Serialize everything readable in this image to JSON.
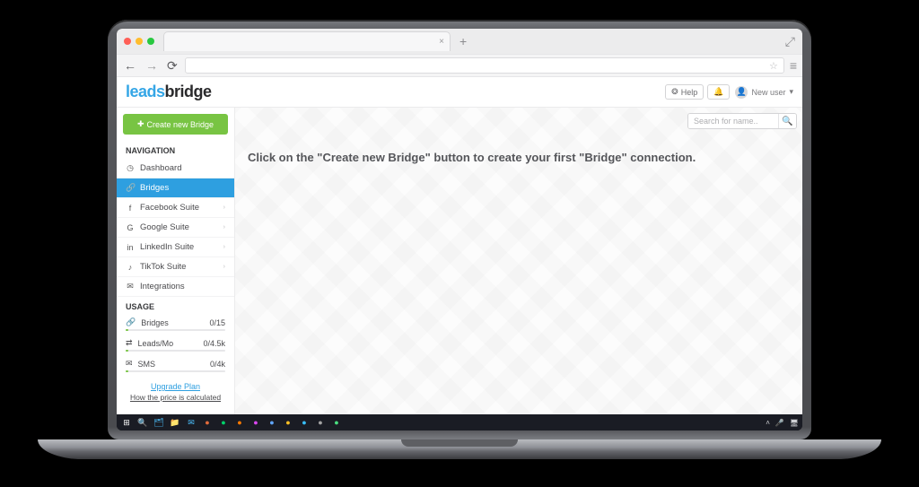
{
  "logo": {
    "part1": "leads",
    "part2": "bridge"
  },
  "header": {
    "help_label": "Help",
    "user_label": "New user"
  },
  "sidebar": {
    "create_label": "Create new Bridge",
    "nav_title": "NAVIGATION",
    "items": [
      {
        "label": "Dashboard"
      },
      {
        "label": "Bridges"
      },
      {
        "label": "Facebook Suite"
      },
      {
        "label": "Google Suite"
      },
      {
        "label": "LinkedIn Suite"
      },
      {
        "label": "TikTok Suite"
      },
      {
        "label": "Integrations"
      }
    ],
    "usage_title": "USAGE",
    "usage": [
      {
        "label": "Bridges",
        "value": "0/15"
      },
      {
        "label": "Leads/Mo",
        "value": "0/4.5k"
      },
      {
        "label": "SMS",
        "value": "0/4k"
      }
    ],
    "upgrade_label": "Upgrade Plan",
    "price_label": "How the price is calculated"
  },
  "main": {
    "search_placeholder": "Search for name..",
    "empty_message": "Click on the \"Create new Bridge\" button to create your first \"Bridge\" connection."
  }
}
